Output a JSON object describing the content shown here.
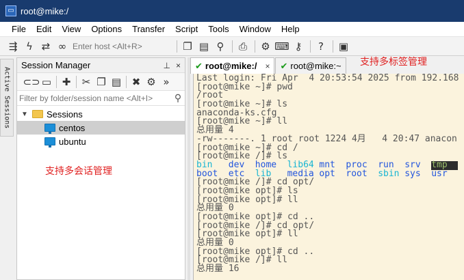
{
  "window": {
    "title": "root@mike:/",
    "icon": "securecrt-app-icon"
  },
  "menu": [
    "File",
    "Edit",
    "View",
    "Options",
    "Transfer",
    "Script",
    "Tools",
    "Window",
    "Help"
  ],
  "toolbar": {
    "host_placeholder": "Enter host <Alt+R>",
    "icons": [
      "connect-icon",
      "quick-connect-icon",
      "reconnect-icon",
      "disconnect-icon",
      "copy-icon",
      "paste-icon",
      "find-icon",
      "print-icon",
      "settings-icon",
      "keymap-icon",
      "key-icon",
      "help-icon",
      "sftp-icon"
    ]
  },
  "vertical_tab": {
    "label": "Active Sessions"
  },
  "session_manager": {
    "title": "Session Manager",
    "pin_glyph": "⊥",
    "close_glyph": "×",
    "more_glyph": "»",
    "filter_placeholder": "Filter by folder/session name <Alt+I>",
    "tree": {
      "folder": "Sessions",
      "items": [
        {
          "label": "centos",
          "selected": true
        },
        {
          "label": "ubuntu",
          "selected": false
        }
      ]
    }
  },
  "annotations": {
    "sessions": "支持多会话管理",
    "tabs": "支持多标签管理"
  },
  "tabs": [
    {
      "label": "root@mike:/",
      "active": true,
      "close": "×"
    },
    {
      "label": "root@mike:~",
      "active": false
    }
  ],
  "terminal": {
    "lines_before": [
      "Last login: Fri Apr  4 20:53:54 2025 from 192.168",
      "[root@mike ~]# pwd",
      "/root",
      "[root@mike ~]# ls",
      "anaconda-ks.cfg",
      "[root@mike ~]# ll",
      "总用量 4",
      "-rw-------. 1 root root 1224 4月   4 20:47 anacon",
      "[root@mike ~]# cd /",
      "[root@mike /]# ls"
    ],
    "ls_row1": [
      {
        "text": "bin",
        "color": "cyan"
      },
      {
        "text": "dev",
        "color": "blue"
      },
      {
        "text": "home",
        "color": "blue"
      },
      {
        "text": "lib64",
        "color": "cyan"
      },
      {
        "text": "mnt",
        "color": "blue"
      },
      {
        "text": "proc",
        "color": "blue"
      },
      {
        "text": "run",
        "color": "blue"
      },
      {
        "text": "srv",
        "color": "blue"
      },
      {
        "text": "tmp",
        "color": "hl"
      }
    ],
    "ls_row2": [
      {
        "text": "boot",
        "color": "blue"
      },
      {
        "text": "etc",
        "color": "blue"
      },
      {
        "text": "lib",
        "color": "cyan"
      },
      {
        "text": "media",
        "color": "blue"
      },
      {
        "text": "opt",
        "color": "blue"
      },
      {
        "text": "root",
        "color": "blue"
      },
      {
        "text": "sbin",
        "color": "cyan"
      },
      {
        "text": "sys",
        "color": "blue"
      },
      {
        "text": "usr",
        "color": "blue"
      }
    ],
    "lines_after": [
      "[root@mike /]# cd opt/",
      "[root@mike opt]# ls",
      "[root@mike opt]# ll",
      "总用量 0",
      "[root@mike opt]# cd ..",
      "[root@mike /]# cd opt/",
      "[root@mike opt]# ll",
      "总用量 0",
      "[root@mike opt]# cd ..",
      "[root@mike /]# ll",
      "总用量 16"
    ]
  }
}
